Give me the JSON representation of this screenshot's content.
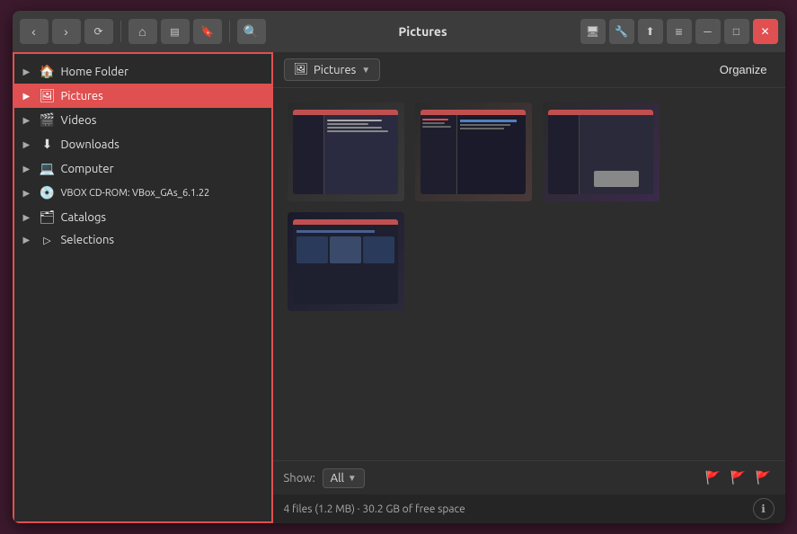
{
  "window": {
    "title": "Pictures",
    "controls": {
      "back": "‹",
      "forward": "›",
      "history": "🕐",
      "home": "⌂",
      "eject": "⏏",
      "bookmarks": "☰",
      "search": "🔍",
      "monitor": "🖥",
      "wrench": "🔧",
      "upload": "⬆",
      "menu": "≡",
      "minimize": "─",
      "maximize": "□",
      "close": "✕"
    }
  },
  "sidebar": {
    "items": [
      {
        "id": "home-folder",
        "label": "Home Folder",
        "icon": "🏠",
        "arrow": "▶",
        "active": false
      },
      {
        "id": "pictures",
        "label": "Pictures",
        "icon": "🖼",
        "arrow": "▶",
        "active": true
      },
      {
        "id": "videos",
        "label": "Videos",
        "icon": "🎬",
        "arrow": "▶",
        "active": false
      },
      {
        "id": "downloads",
        "label": "Downloads",
        "icon": "⬇",
        "arrow": "▶",
        "active": false
      },
      {
        "id": "computer",
        "label": "Computer",
        "icon": "💻",
        "arrow": "▶",
        "active": false
      },
      {
        "id": "vbox",
        "label": "VBOX CD-ROM: VBox_GAs_6.1.22",
        "icon": "💿",
        "arrow": "▶",
        "active": false
      },
      {
        "id": "catalogs",
        "label": "Catalogs",
        "icon": "🗂",
        "arrow": "▶",
        "active": false
      },
      {
        "id": "selections",
        "label": "Selections",
        "icon": "▷",
        "arrow": "▶",
        "active": false
      }
    ]
  },
  "location": {
    "icon": "🖼",
    "path": "Pictures",
    "organize_label": "Organize"
  },
  "thumbnails": [
    {
      "id": "thumb-1",
      "desc": "screenshot-1"
    },
    {
      "id": "thumb-2",
      "desc": "screenshot-2"
    },
    {
      "id": "thumb-3",
      "desc": "screenshot-3"
    },
    {
      "id": "thumb-4",
      "desc": "screenshot-4"
    }
  ],
  "bottom": {
    "show_label": "Show:",
    "show_value": "All",
    "flags": {
      "green": "🚩",
      "red": "🚩",
      "blue": "🚩"
    }
  },
  "statusbar": {
    "text": "4 files (1.2 MB)  ·  30.2 GB of free space",
    "info": "ℹ"
  }
}
